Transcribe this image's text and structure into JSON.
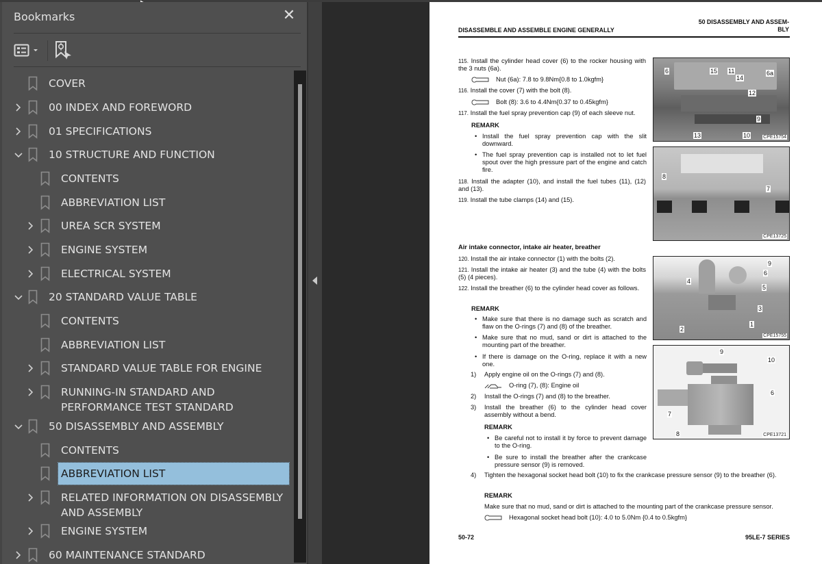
{
  "sidebar": {
    "title": "Bookmarks",
    "close_icon": "close-icon",
    "toolbar": {
      "options_icon": "list-options-icon",
      "find_icon": "find-current-bookmark-icon"
    },
    "items": [
      {
        "label": "COVER",
        "level": 0,
        "expander": "none"
      },
      {
        "label": "00 INDEX AND FOREWORD",
        "level": 0,
        "expander": "collapsed"
      },
      {
        "label": "01 SPECIFICATIONS",
        "level": 0,
        "expander": "collapsed"
      },
      {
        "label": "10 STRUCTURE AND FUNCTION",
        "level": 0,
        "expander": "expanded"
      },
      {
        "label": "CONTENTS",
        "level": 1,
        "expander": "none"
      },
      {
        "label": "ABBREVIATION LIST",
        "level": 1,
        "expander": "none"
      },
      {
        "label": "UREA SCR SYSTEM",
        "level": 1,
        "expander": "collapsed"
      },
      {
        "label": "ENGINE SYSTEM",
        "level": 1,
        "expander": "collapsed"
      },
      {
        "label": "ELECTRICAL SYSTEM",
        "level": 1,
        "expander": "collapsed"
      },
      {
        "label": "20 STANDARD VALUE TABLE",
        "level": 0,
        "expander": "expanded"
      },
      {
        "label": "CONTENTS",
        "level": 1,
        "expander": "none"
      },
      {
        "label": "ABBREVIATION LIST",
        "level": 1,
        "expander": "none"
      },
      {
        "label": "STANDARD VALUE TABLE FOR ENGINE",
        "level": 1,
        "expander": "collapsed"
      },
      {
        "label": "RUNNING-IN STANDARD AND PERFORMANCE TEST STANDARD",
        "level": 1,
        "expander": "collapsed"
      },
      {
        "label": "50 DISASSEMBLY AND ASSEMBLY",
        "level": 0,
        "expander": "expanded"
      },
      {
        "label": "CONTENTS",
        "level": 1,
        "expander": "none"
      },
      {
        "label": "ABBREVIATION LIST",
        "level": 1,
        "expander": "none",
        "selected": true
      },
      {
        "label": "RELATED INFORMATION ON DISASSEMBLY AND ASSEMBLY",
        "level": 1,
        "expander": "collapsed"
      },
      {
        "label": "ENGINE SYSTEM",
        "level": 1,
        "expander": "collapsed"
      },
      {
        "label": "60 MAINTENANCE STANDARD",
        "level": 0,
        "expander": "collapsed"
      }
    ],
    "selected_color": "#94bfdc"
  },
  "document": {
    "header_left": "DISASSEMBLE AND ASSEMBLE ENGINE GENERALLY",
    "header_right_1": "50 DISASSEMBLY AND ASSEM-",
    "header_right_2": "BLY",
    "steps": {
      "s115_num": "115.",
      "s115": "Install the cylinder head cover (6) to the rocker housing with the 3 nuts (6a).",
      "t115": "Nut (6a): 7.8 to 9.8Nm{0.8 to 1.0kgfm}",
      "s116_num": "116.",
      "s116": "Install the cover (7) with the bolt (8).",
      "t116": "Bolt (8): 3.6 to 4.4Nm{0.37 to 0.45kgfm}",
      "s117_num": "117.",
      "s117": "Install the fuel spray prevention cap (9) of each sleeve nut.",
      "remark": "REMARK",
      "r117a": "Install the fuel spray prevention cap with the slit downward.",
      "r117b": "The fuel spray prevention cap is installed not to let fuel spout over the high pressure part of the engine and catch fire.",
      "s118_num": "118.",
      "s118": "Install the adapter (10), and install the fuel tubes (11), (12) and (13).",
      "s119_num": "119.",
      "s119": "Install the tube clamps (14) and (15).",
      "section2": "Air intake connector, intake air heater, breather",
      "s120_num": "120.",
      "s120": "Install the air intake connector (1) with the bolts (2).",
      "s121_num": "121.",
      "s121": "Install the intake air heater (3) and the tube (4) with the bolts (5) (4 pieces).",
      "s122_num": "122.",
      "s122": "Install the breather (6) to the cylinder head cover as follows.",
      "r122a": "Make sure that there is no damage such as scratch and flaw on the O-rings (7) and (8) of the breather.",
      "r122b": "Make sure that no mud, sand or dirt is attached to the mounting part of the breather.",
      "r122c": "If there is damage on the O-ring, replace it with a new one.",
      "sub1_num": "1)",
      "sub1": "Apply engine oil on the O-rings (7) and (8).",
      "oil1": "O-ring (7), (8): Engine oil",
      "sub2_num": "2)",
      "sub2": "Install the O-rings (7) and (8) to the breather.",
      "sub3_num": "3)",
      "sub3": "Install the breather (6) to the cylinder head cover assembly without a bend.",
      "r3a": "Be careful not to install it by force to prevent damage to the O-ring.",
      "r3b": "Be sure to install the breather after the crankcase pressure sensor (9) is removed.",
      "sub4_num": "4)",
      "sub4": "Tighten the hexagonal socket head bolt (10) to fix the crankcase pressure sensor (9) to the breather (6).",
      "r4": "Make sure that no mud, sand or dirt is attached to the mounting part of the crankcase pressure sensor.",
      "t4": "Hexagonal socket head bolt (10): 4.0 to 5.0Nm {0.4 to 0.5kgfm}"
    },
    "figures": [
      {
        "code": "CPE15754",
        "callouts": [
          "6",
          "15",
          "11",
          "14",
          "6a",
          "12",
          "9",
          "13",
          "10"
        ]
      },
      {
        "code": "CPE13725",
        "callouts": [
          "8",
          "7"
        ]
      },
      {
        "code": "CPE15755",
        "callouts": [
          "9",
          "6",
          "4",
          "5",
          "3",
          "1",
          "2"
        ]
      },
      {
        "code": "CPE13721",
        "callouts": [
          "9",
          "10",
          "6",
          "7",
          "8"
        ]
      }
    ],
    "footer_left": "50-72",
    "footer_right": "95LE-7 SERIES"
  }
}
